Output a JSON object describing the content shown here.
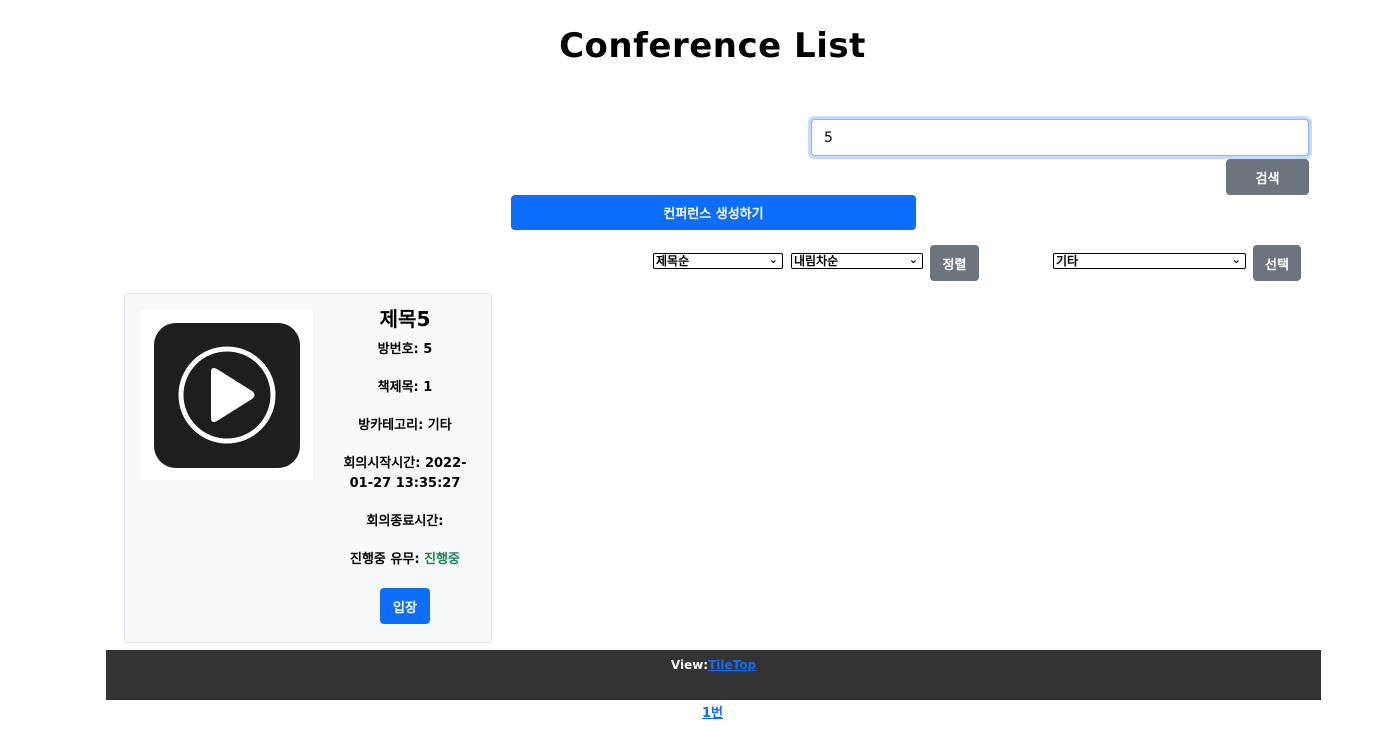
{
  "header": {
    "title": "Conference List"
  },
  "search": {
    "value": "5",
    "button_label": "검색"
  },
  "create_button_label": "컨퍼런스 생성하기",
  "sort": {
    "field_selected": "제목순",
    "order_selected": "내림차순",
    "button_label": "정렬"
  },
  "category": {
    "selected": "기타",
    "button_label": "선택"
  },
  "conferences": [
    {
      "thumbnail_icon": "play-button-icon",
      "title": "제목5",
      "room_number_label": "방번호:",
      "room_number": "5",
      "book_title_label": "책제목:",
      "book_title": "1",
      "category_label": "방카테고리:",
      "category": "기타",
      "start_time_label": "회의시작시간:",
      "start_time": "2022-01-27 13:35:27",
      "end_time_label": "회의종료시간:",
      "end_time": "",
      "status_label": "진행중 유무:",
      "status": "진행중",
      "join_label": "입장"
    }
  ],
  "footer": {
    "view_label": "View:",
    "view_tile": "Tile",
    "view_top": "Top"
  },
  "pagination": {
    "page_label": "1번"
  },
  "colors": {
    "primary": "#0d6efd",
    "secondary": "#6c757d",
    "status_active": "#198754",
    "footer_bg": "#333333"
  }
}
